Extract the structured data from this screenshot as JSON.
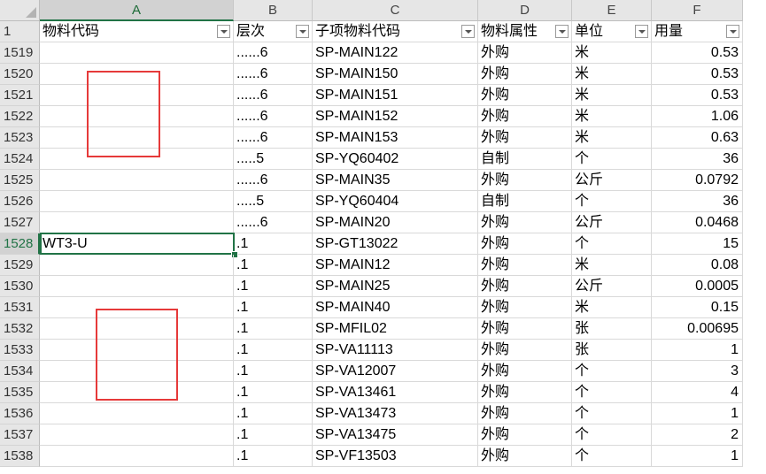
{
  "columns": [
    "A",
    "B",
    "C",
    "D",
    "E",
    "F"
  ],
  "header_row": {
    "row_number": "1",
    "cells": [
      "物料代码",
      "层次",
      "子项物料代码",
      "物料属性",
      "单位",
      "用量"
    ]
  },
  "rows": [
    {
      "row": "1519",
      "a": "",
      "b": "......6",
      "c": "SP-MAIN122",
      "d": "外购",
      "e": "米",
      "f": "0.53"
    },
    {
      "row": "1520",
      "a": "",
      "b": "......6",
      "c": "SP-MAIN150",
      "d": "外购",
      "e": "米",
      "f": "0.53"
    },
    {
      "row": "1521",
      "a": "",
      "b": "......6",
      "c": "SP-MAIN151",
      "d": "外购",
      "e": "米",
      "f": "0.53"
    },
    {
      "row": "1522",
      "a": "",
      "b": "......6",
      "c": "SP-MAIN152",
      "d": "外购",
      "e": "米",
      "f": "1.06"
    },
    {
      "row": "1523",
      "a": "",
      "b": "......6",
      "c": "SP-MAIN153",
      "d": "外购",
      "e": "米",
      "f": "0.63"
    },
    {
      "row": "1524",
      "a": "",
      "b": ".....5",
      "c": "SP-YQ60402",
      "d": "自制",
      "e": "个",
      "f": "36"
    },
    {
      "row": "1525",
      "a": "",
      "b": "......6",
      "c": "SP-MAIN35",
      "d": "外购",
      "e": "公斤",
      "f": "0.0792"
    },
    {
      "row": "1526",
      "a": "",
      "b": ".....5",
      "c": "SP-YQ60404",
      "d": "自制",
      "e": "个",
      "f": "36"
    },
    {
      "row": "1527",
      "a": "",
      "b": "......6",
      "c": "SP-MAIN20",
      "d": "外购",
      "e": "公斤",
      "f": "0.0468"
    },
    {
      "row": "1528",
      "a": "WT3-U",
      "b": ".1",
      "c": "SP-GT13022",
      "d": "外购",
      "e": "个",
      "f": "15"
    },
    {
      "row": "1529",
      "a": "",
      "b": ".1",
      "c": "SP-MAIN12",
      "d": "外购",
      "e": "米",
      "f": "0.08"
    },
    {
      "row": "1530",
      "a": "",
      "b": ".1",
      "c": "SP-MAIN25",
      "d": "外购",
      "e": "公斤",
      "f": "0.0005"
    },
    {
      "row": "1531",
      "a": "",
      "b": ".1",
      "c": "SP-MAIN40",
      "d": "外购",
      "e": "米",
      "f": "0.15"
    },
    {
      "row": "1532",
      "a": "",
      "b": ".1",
      "c": "SP-MFIL02",
      "d": "外购",
      "e": "张",
      "f": "0.00695"
    },
    {
      "row": "1533",
      "a": "",
      "b": ".1",
      "c": "SP-VA11113",
      "d": "外购",
      "e": "张",
      "f": "1"
    },
    {
      "row": "1534",
      "a": "",
      "b": ".1",
      "c": "SP-VA12007",
      "d": "外购",
      "e": "个",
      "f": "3"
    },
    {
      "row": "1535",
      "a": "",
      "b": ".1",
      "c": "SP-VA13461",
      "d": "外购",
      "e": "个",
      "f": "4"
    },
    {
      "row": "1536",
      "a": "",
      "b": ".1",
      "c": "SP-VA13473",
      "d": "外购",
      "e": "个",
      "f": "1"
    },
    {
      "row": "1537",
      "a": "",
      "b": ".1",
      "c": "SP-VA13475",
      "d": "外购",
      "e": "个",
      "f": "2"
    },
    {
      "row": "1538",
      "a": "",
      "b": ".1",
      "c": "SP-VF13503",
      "d": "外购",
      "e": "个",
      "f": "1"
    }
  ],
  "selection": {
    "cell": "A1528",
    "row": "1528",
    "column": "A"
  },
  "colors": {
    "accent": "#217346",
    "annotation": "#e63a3a",
    "header_bg": "#e6e6e6",
    "grid": "#d9d9d9"
  },
  "icons": {
    "filter_button": "filter-dropdown-icon",
    "select_all": "select-all-triangle-icon"
  }
}
